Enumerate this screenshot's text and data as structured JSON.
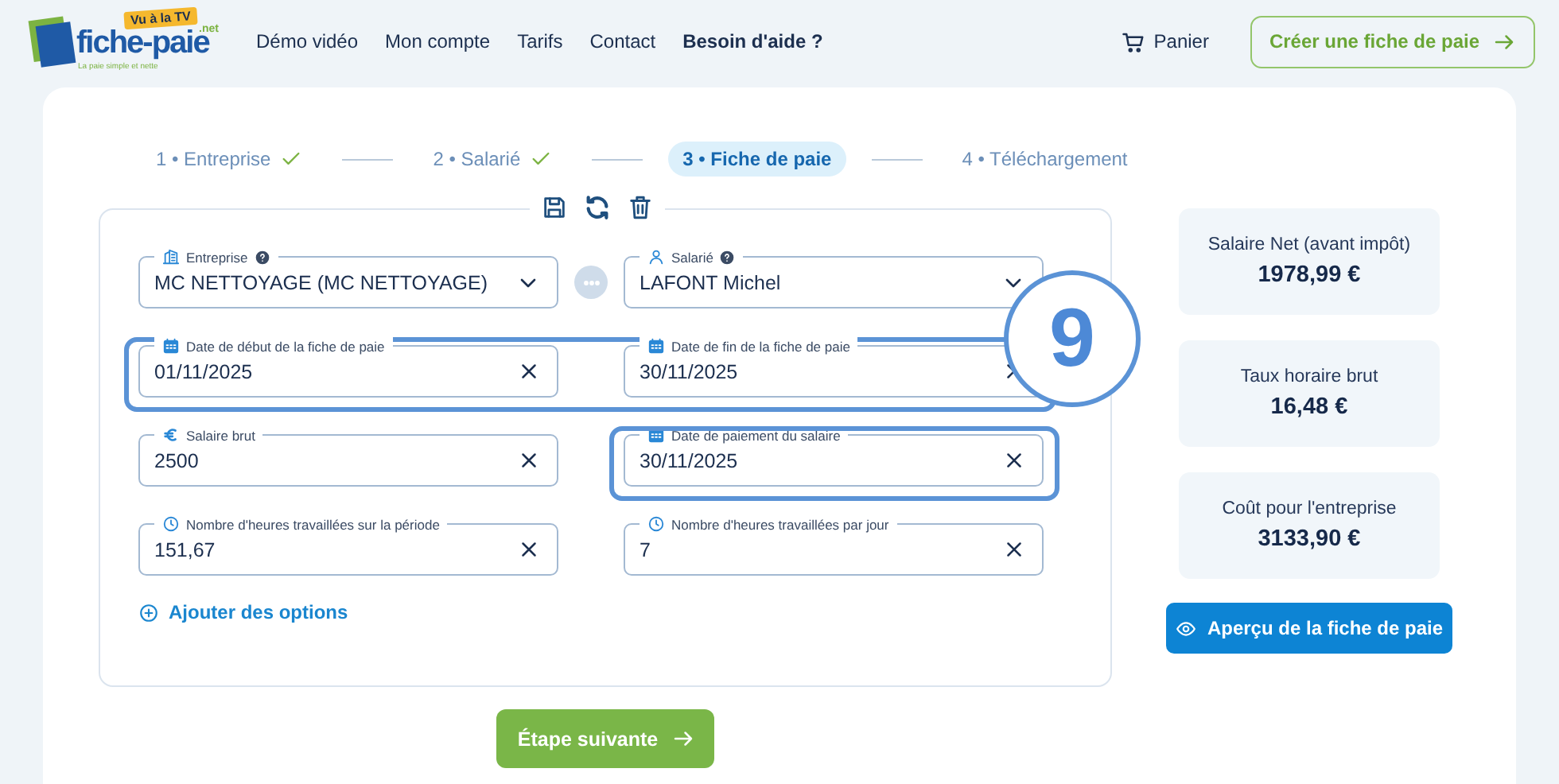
{
  "header": {
    "logo": {
      "badge": "Vu à la TV",
      "name": "fiche-paie",
      "suffix": ".net",
      "tagline": "La paie simple et nette"
    },
    "nav": [
      {
        "label": "Démo vidéo",
        "bold": false
      },
      {
        "label": "Mon compte",
        "bold": false
      },
      {
        "label": "Tarifs",
        "bold": false
      },
      {
        "label": "Contact",
        "bold": false
      },
      {
        "label": "Besoin d'aide ?",
        "bold": true
      }
    ],
    "cart": "Panier",
    "cta": "Créer une fiche de paie"
  },
  "steps": [
    {
      "number": "1 •",
      "label": "Entreprise",
      "done": true,
      "selected": false
    },
    {
      "number": "2 •",
      "label": "Salarié",
      "done": true,
      "selected": false
    },
    {
      "number": "3 •",
      "label": "Fiche de paie",
      "done": false,
      "selected": true
    },
    {
      "number": "4 •",
      "label": "Téléchargement",
      "done": false,
      "selected": false
    }
  ],
  "form": {
    "rows": [
      {
        "highlighted": false,
        "more_button": true,
        "fields": [
          {
            "kind": "company",
            "label": "Entreprise",
            "help": true,
            "value": "MC NETTOYAGE (MC NETTOYAGE)",
            "highlighted": false
          },
          {
            "kind": "employee",
            "label": "Salarié",
            "help": true,
            "value": "LAFONT Michel",
            "highlighted": false
          }
        ]
      },
      {
        "highlighted": true,
        "more_button": false,
        "fields": [
          {
            "kind": "date",
            "label": "Date de début de la fiche de paie",
            "help": false,
            "value": "01/11/2025",
            "highlighted": false
          },
          {
            "kind": "date",
            "label": "Date de fin de la fiche de paie",
            "help": false,
            "value": "30/11/2025",
            "highlighted": false
          }
        ]
      },
      {
        "highlighted": false,
        "more_button": false,
        "fields": [
          {
            "kind": "amount",
            "label": "Salaire brut",
            "help": false,
            "value": "2500",
            "highlighted": false
          },
          {
            "kind": "date",
            "label": "Date de paiement du salaire",
            "help": false,
            "value": "30/11/2025",
            "highlighted": true
          }
        ]
      },
      {
        "highlighted": false,
        "more_button": false,
        "fields": [
          {
            "kind": "hours",
            "label": "Nombre d'heures travaillées sur la période",
            "help": false,
            "value": "151,67",
            "highlighted": false
          },
          {
            "kind": "hours",
            "label": "Nombre d'heures travaillées par jour",
            "help": false,
            "value": "7",
            "highlighted": false
          }
        ]
      }
    ],
    "add_options": "Ajouter des options",
    "callout": "9"
  },
  "summary": [
    {
      "label": "Salaire Net (avant impôt)",
      "value": "1978,99 €"
    },
    {
      "label": "Taux horaire brut",
      "value": "16,48 €"
    },
    {
      "label": "Coût pour l'entreprise",
      "value": "3133,90 €"
    }
  ],
  "preview_button": "Aperçu de la fiche de paie",
  "next_button": "Étape suivante"
}
